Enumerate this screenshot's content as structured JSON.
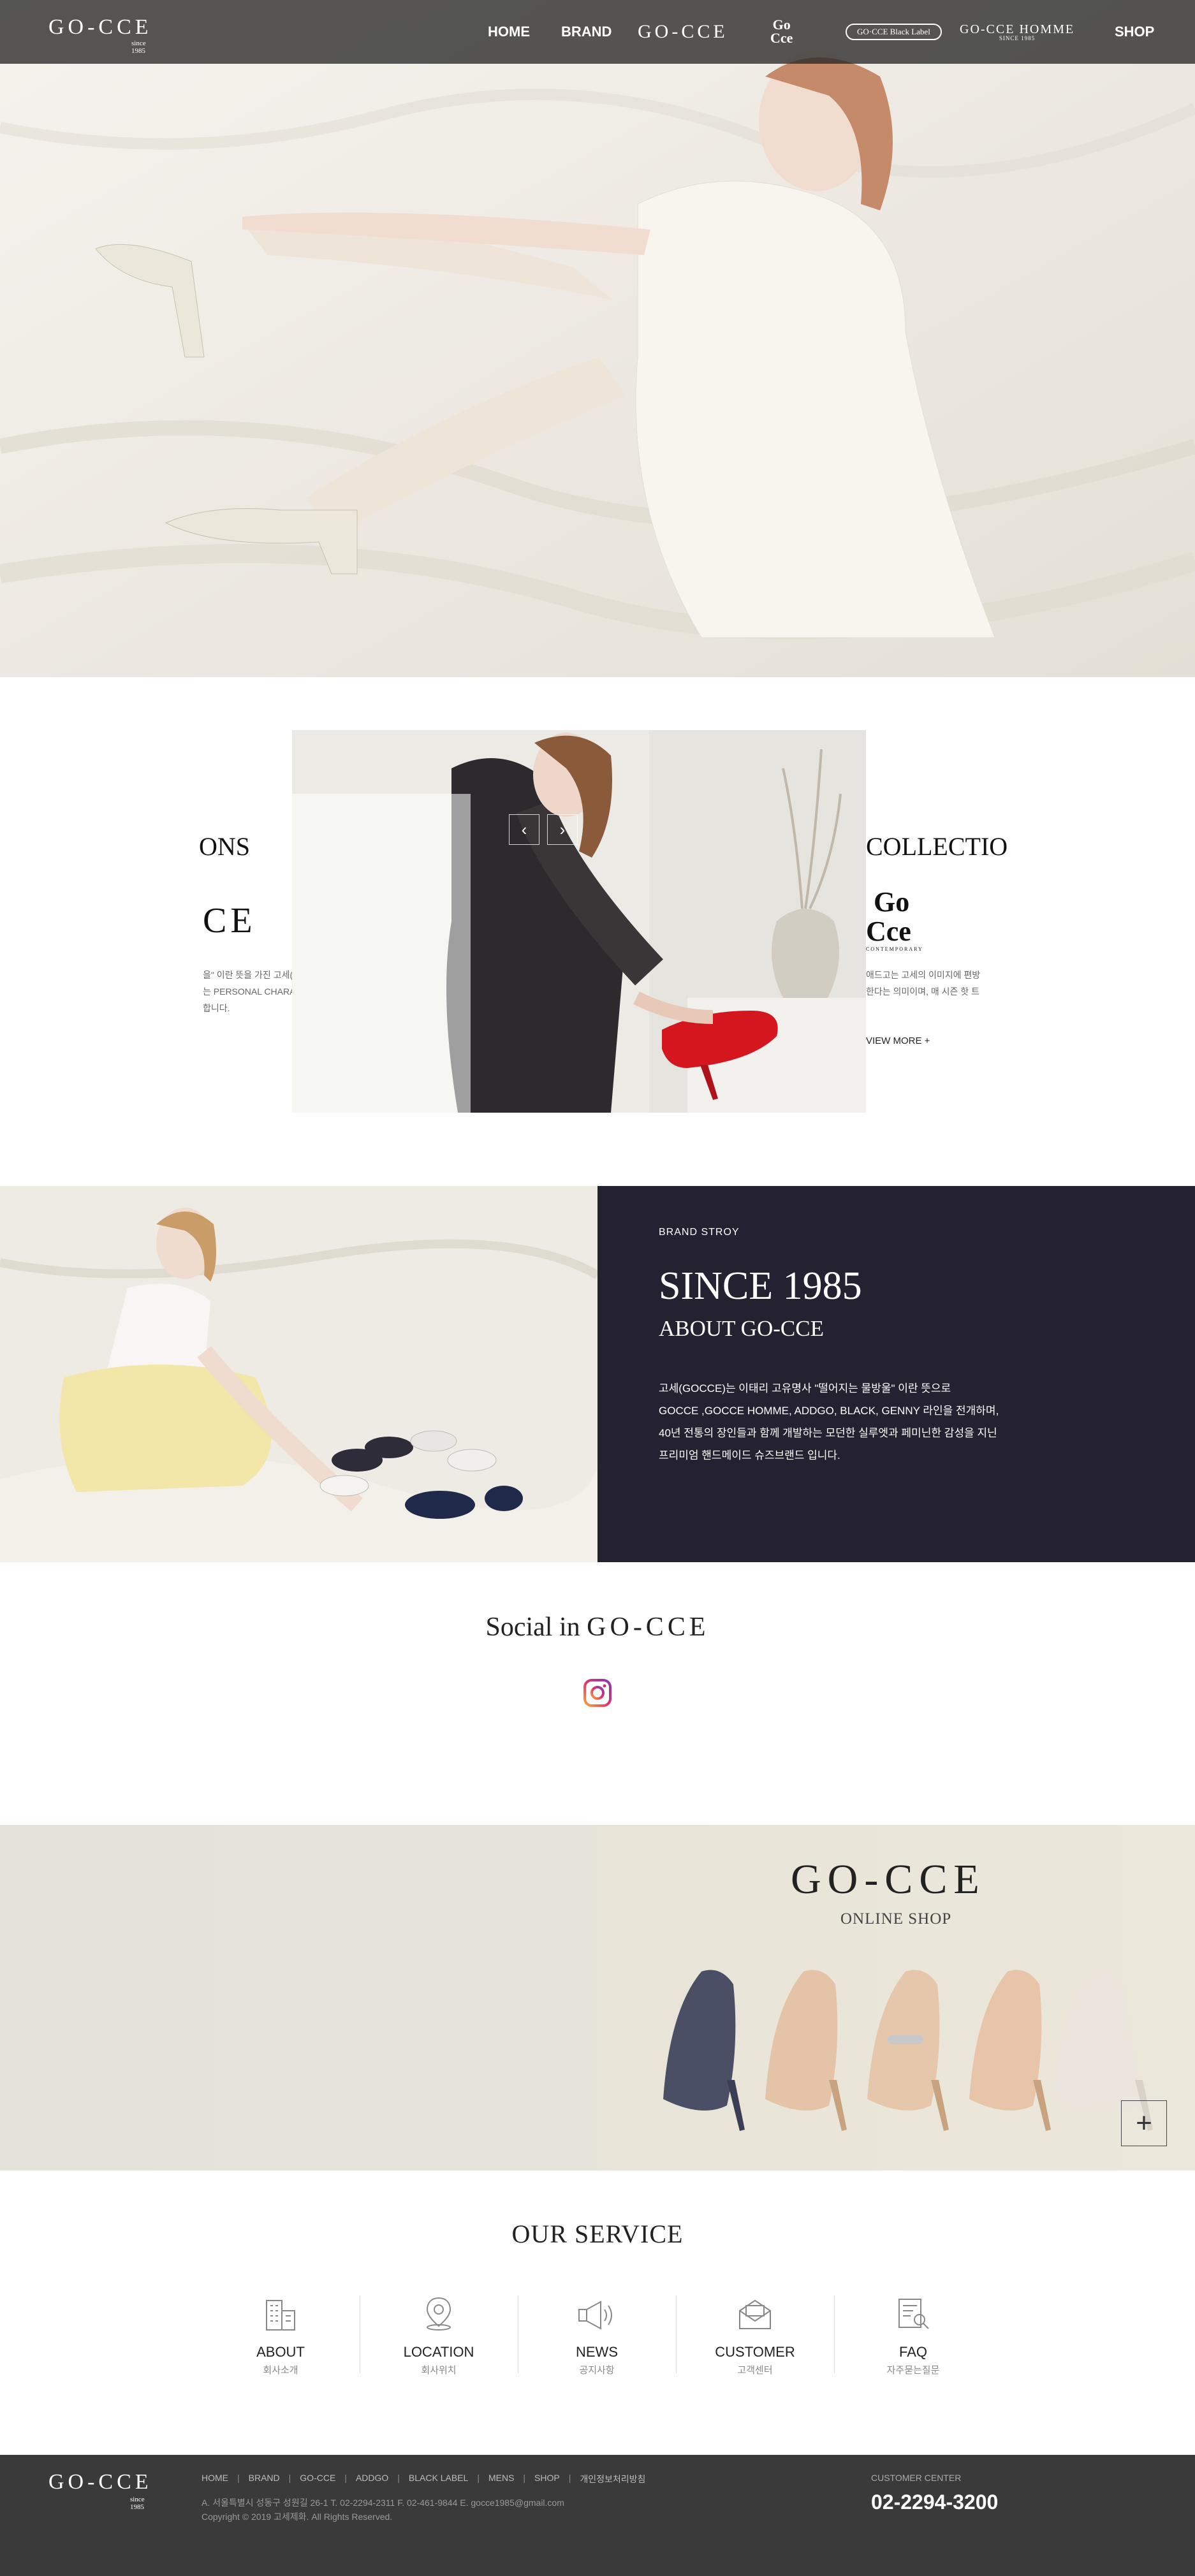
{
  "header": {
    "logo": "GO-CCE",
    "logo_since": "since 1985",
    "nav": {
      "home": "HOME",
      "brand": "BRAND",
      "gocce": "GO-CCE",
      "gocce_c1": "Go",
      "gocce_c2": "Cce",
      "black_label": "GO·CCE Black Label",
      "homme": "GO-CCE HOMME",
      "homme_since": "SINCE 1985",
      "shop": "SHOP"
    }
  },
  "collection": {
    "left_title": "ONS",
    "left_logo": "CE",
    "left_text_1": "을\" 이란 뜻을 가진 고세(GO·CCE)는",
    "left_text_2": "는 PERSONAL CHARACTER 를 추구하며,",
    "left_text_3": "합니다.",
    "right_title": "COLLECTIO",
    "right_logo_1": "Go",
    "right_logo_2": "Cce",
    "right_logo_sub": "CONTEMPORARY",
    "right_text_1": "애드고는 고세의 이미지에 편방",
    "right_text_2": "한다는 의미이며, 매 시즌 핫 트",
    "view_more": "VIEW MORE +",
    "prev": "‹",
    "next": "›"
  },
  "story": {
    "label": "BRAND STROY",
    "since": "SINCE 1985",
    "about": "ABOUT GO-CCE",
    "line1": "고세(GOCCE)는 이태리 고유명사 \"떨어지는 물방울\" 이란 뜻으로",
    "line2": "GOCCE ,GOCCE HOMME, ADDGO, BLACK, GENNY 라인을 전개하며,",
    "line3": "40년 전통의 장인들과 함께 개발하는 모던한 실루엣과 페미닌한 감성을 지닌",
    "line4": "프리미엄 핸드메이드 슈즈브랜드 입니다."
  },
  "social": {
    "title_a": "Social in ",
    "title_b": "GO-CCE"
  },
  "shop": {
    "logo": "GO-CCE",
    "sub": "ONLINE SHOP",
    "plus": "+"
  },
  "service": {
    "title": "OUR SERVICE",
    "items": [
      {
        "en": "ABOUT",
        "ko": "회사소개"
      },
      {
        "en": "LOCATION",
        "ko": "회사위치"
      },
      {
        "en": "NEWS",
        "ko": "공지사항"
      },
      {
        "en": "CUSTOMER",
        "ko": "고객센터"
      },
      {
        "en": "FAQ",
        "ko": "자주묻는질문"
      }
    ]
  },
  "footer": {
    "logo": "GO-CCE",
    "logo_since": "since 1985",
    "nav": [
      "HOME",
      "BRAND",
      "GO-CCE",
      "ADDGO",
      "BLACK LABEL",
      "MENS",
      "SHOP",
      "개인정보처리방침"
    ],
    "addr": "A. 서울특별시 성동구 성원길 26-1   T. 02-2294-2311   F. 02-461-9844   E. gocce1985@gmail.com",
    "copy": "Copyright © 2019 고세제화. All Rights Reserved.",
    "cc_label": "CUSTOMER CENTER",
    "cc_phone": "02-2294-3200"
  }
}
